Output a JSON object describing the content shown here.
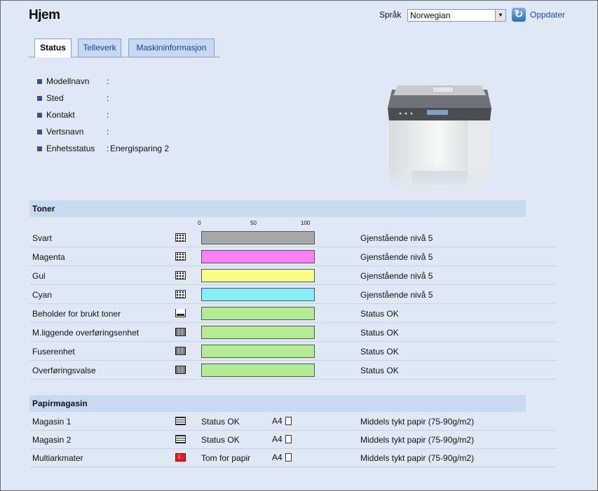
{
  "page": {
    "title": "Hjem"
  },
  "header": {
    "language_label": "Språk",
    "language_value": "Norwegian",
    "refresh_label": "Oppdater"
  },
  "tabs": [
    {
      "label": "Status",
      "active": true
    },
    {
      "label": "Telleverk",
      "active": false
    },
    {
      "label": "Maskininformasjon",
      "active": false
    }
  ],
  "device_info": [
    {
      "label": "Modellnavn",
      "value": ""
    },
    {
      "label": "Sted",
      "value": ""
    },
    {
      "label": "Kontakt",
      "value": ""
    },
    {
      "label": "Vertsnavn",
      "value": ""
    },
    {
      "label": "Enhetsstatus",
      "value": "Energisparing 2"
    }
  ],
  "toner": {
    "title": "Toner",
    "scale": [
      "0",
      "50",
      "100"
    ],
    "items": [
      {
        "name": "Svart",
        "icon": "toner-level-icon",
        "level_percent": 100,
        "color": "#a8a8a8",
        "status": "Gjenstående nivå 5"
      },
      {
        "name": "Magenta",
        "icon": "toner-level-icon",
        "level_percent": 100,
        "color": "#ff80f2",
        "status": "Gjenstående nivå 5"
      },
      {
        "name": "Gul",
        "icon": "toner-level-icon",
        "level_percent": 100,
        "color": "#fbfb8a",
        "status": "Gjenstående nivå 5"
      },
      {
        "name": "Cyan",
        "icon": "toner-level-icon",
        "level_percent": 100,
        "color": "#86f0f6",
        "status": "Gjenstående nivå 5"
      },
      {
        "name": "Beholder for brukt toner",
        "icon": "waste-toner-icon",
        "level_percent": 100,
        "color": "#b2ec95",
        "status": "Status OK"
      },
      {
        "name": "M.liggende overføringsenhet",
        "icon": "unit-ok-icon",
        "level_percent": 100,
        "color": "#b2ec95",
        "status": "Status OK"
      },
      {
        "name": "Fuserenhet",
        "icon": "unit-ok-icon",
        "level_percent": 100,
        "color": "#b2ec95",
        "status": "Status OK"
      },
      {
        "name": "Overføringsvalse",
        "icon": "unit-ok-icon",
        "level_percent": 100,
        "color": "#b2ec95",
        "status": "Status OK"
      }
    ]
  },
  "paper": {
    "title": "Papirmagasin",
    "items": [
      {
        "name": "Magasin 1",
        "icon": "paper-tray-icon",
        "status": "Status OK",
        "size": "A4",
        "type": "Middels tykt papir (75-90g/m2)"
      },
      {
        "name": "Magasin 2",
        "icon": "paper-tray-icon",
        "status": "Status OK",
        "size": "A4",
        "type": "Middels tykt papir (75-90g/m2)"
      },
      {
        "name": "Multiarkmater",
        "icon": "paper-empty-icon",
        "status": "Tom for papir",
        "size": "A4",
        "type": "Middels tykt papir (75-90g/m2)"
      }
    ]
  }
}
